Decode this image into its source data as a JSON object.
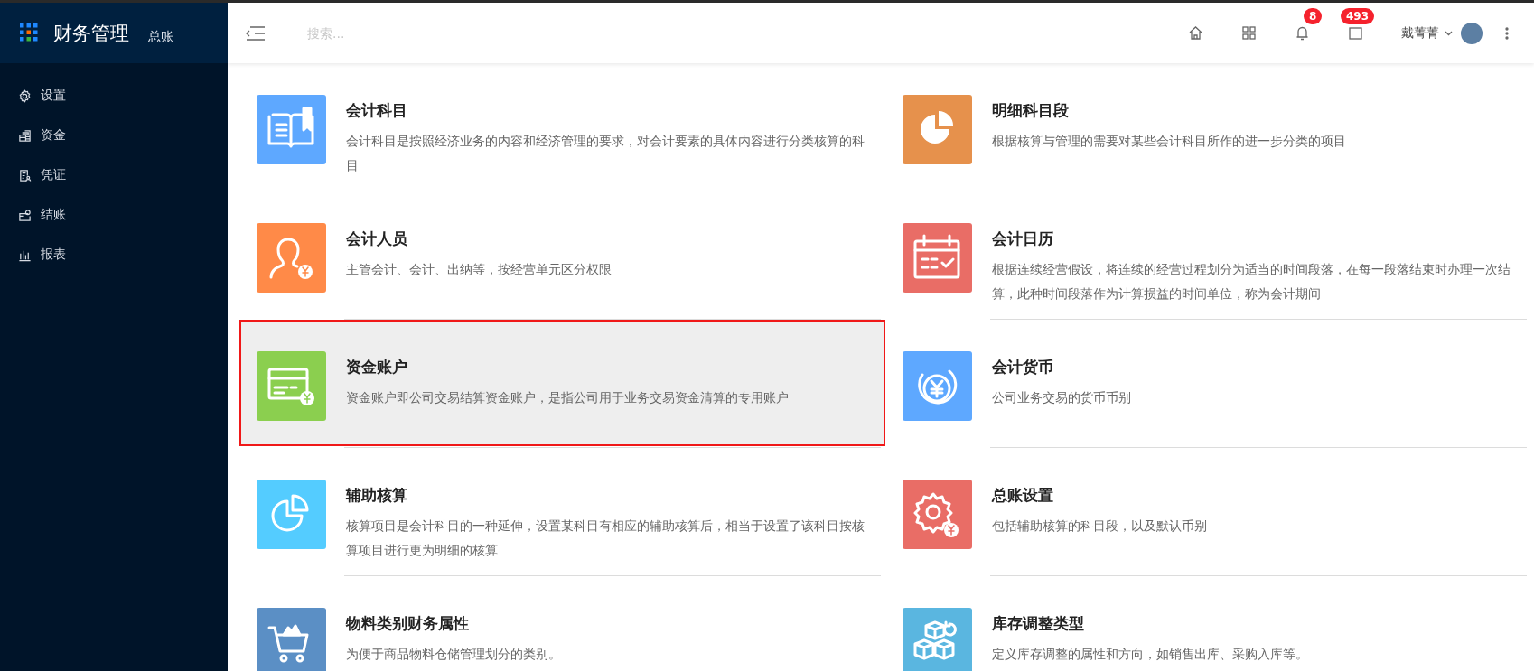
{
  "sidebar": {
    "logo_title": "财务管理",
    "logo_subtitle": "总账",
    "items": [
      {
        "label": "设置",
        "kind": "gear"
      },
      {
        "label": "资金",
        "kind": "coins"
      },
      {
        "label": "凭证",
        "kind": "voucher"
      },
      {
        "label": "结账",
        "kind": "wallet"
      },
      {
        "label": "报表",
        "kind": "bars"
      }
    ]
  },
  "header": {
    "search": {
      "placeholder": "搜索..."
    },
    "notification_count": "8",
    "message_count": "493",
    "user_name": "戴菁菁"
  },
  "cards": [
    {
      "title": "会计科目",
      "description": "会计科目是按照经济业务的内容和经济管理的要求，对会计要素的具体内容进行分类核算的科目",
      "kind": "book",
      "color": "#5ea8ff",
      "selected": false
    },
    {
      "title": "明细科目段",
      "description": "根据核算与管理的需要对某些会计科目所作的进一步分类的项目",
      "kind": "pie",
      "color": "#e6914c",
      "selected": false
    },
    {
      "title": "会计人员",
      "description": "主管会计、会计、出纳等，按经营单元区分权限",
      "kind": "person",
      "color": "#ff8a48",
      "selected": false
    },
    {
      "title": "会计日历",
      "description": "根据连续经营假设，将连续的经营过程划分为适当的时间段落，在每一段落结束时办理一次结算，此种时间段落作为计算损益的时间单位，称为会计期间",
      "kind": "calendar",
      "color": "#e96d66",
      "selected": false
    },
    {
      "title": "资金账户",
      "description": "资金账户即公司交易结算资金账户，是指公司用于业务交易资金清算的专用账户",
      "kind": "card",
      "color": "#8bcf4f",
      "selected": true
    },
    {
      "title": "会计货币",
      "description": "公司业务交易的货币币别",
      "kind": "currency",
      "color": "#5ea8ff",
      "selected": false
    },
    {
      "title": "辅助核算",
      "description": "核算项目是会计科目的一种延伸，设置某科目有相应的辅助核算后，相当于设置了该科目按核算项目进行更为明细的核算",
      "kind": "chart",
      "color": "#54ccff",
      "selected": false
    },
    {
      "title": "总账设置",
      "description": "包括辅助核算的科目段，以及默认币别",
      "kind": "gear",
      "color": "#e96d66",
      "selected": false
    },
    {
      "title": "物料类别财务属性",
      "description": "为便于商品物料仓储管理划分的类别。",
      "kind": "cart",
      "color": "#5b8fc5",
      "selected": false
    },
    {
      "title": "库存调整类型",
      "description": "定义库存调整的属性和方向，如销售出库、采购入库等。",
      "kind": "boxes",
      "color": "#5ab6e0",
      "selected": false
    }
  ]
}
